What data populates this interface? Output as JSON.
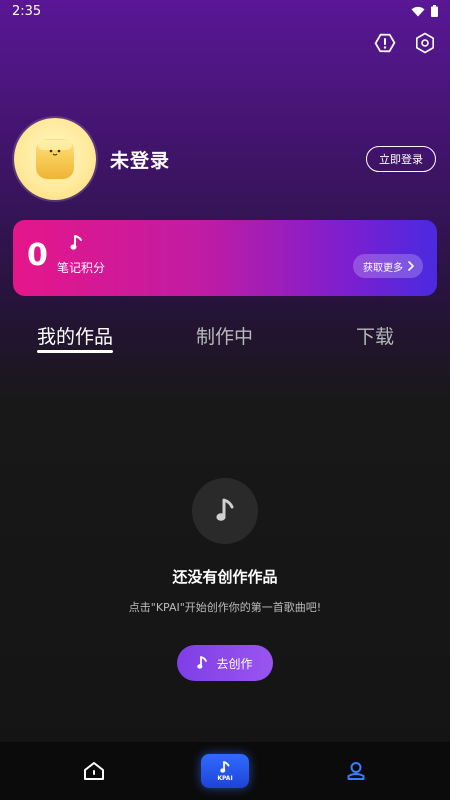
{
  "status_bar": {
    "time": "2:35"
  },
  "profile": {
    "username": "未登录",
    "login_button": "立即登录"
  },
  "points": {
    "value": "0",
    "label": "笔记积分",
    "more_button": "获取更多"
  },
  "tabs": [
    {
      "label": "我的作品",
      "active": true
    },
    {
      "label": "制作中",
      "active": false
    },
    {
      "label": "下载",
      "active": false
    }
  ],
  "empty_state": {
    "title": "还没有创作作品",
    "description": "点击\"KPAI\"开始创作你的第一首歌曲吧!",
    "button": "去创作"
  },
  "bottom_nav": {
    "items": [
      {
        "icon": "home-icon"
      },
      {
        "icon": "music-note-icon",
        "label": "KPAI"
      },
      {
        "icon": "profile-icon"
      }
    ]
  },
  "colors": {
    "accent_purple": "#8a4ae8",
    "card_pink": "#e5168a",
    "card_blue": "#4a2ae0",
    "nav_blue": "#2f6bff"
  }
}
